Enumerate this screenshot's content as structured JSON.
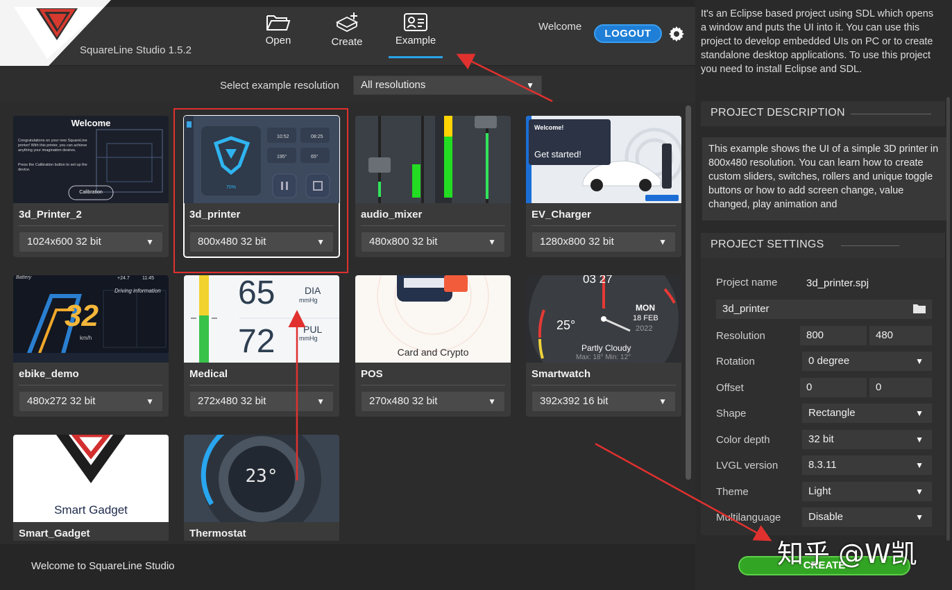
{
  "app": {
    "name": "SquareLine Studio 1.5.2",
    "welcome": "Welcome",
    "logout": "LOGOUT"
  },
  "nav": [
    {
      "label": "Open",
      "icon": "folder-icon"
    },
    {
      "label": "Create",
      "icon": "create-icon"
    },
    {
      "label": "Example",
      "icon": "example-icon",
      "active": true
    }
  ],
  "resolution": {
    "label": "Select example resolution",
    "value": "All resolutions"
  },
  "examples": [
    {
      "name": "3d_Printer_2",
      "res": "1024x600 32 bit"
    },
    {
      "name": "3d_printer",
      "res": "800x480 32 bit",
      "selected": true
    },
    {
      "name": "audio_mixer",
      "res": "480x800 32 bit"
    },
    {
      "name": "EV_Charger",
      "res": "1280x800 32 bit"
    },
    {
      "name": "ebike_demo",
      "res": "480x272 32 bit"
    },
    {
      "name": "Medical",
      "res": "272x480 32 bit"
    },
    {
      "name": "POS",
      "res": "270x480 32 bit"
    },
    {
      "name": "Smartwatch",
      "res": "392x392 16 bit"
    },
    {
      "name": "Smart_Gadget",
      "res": ""
    },
    {
      "name": "Thermostat",
      "res": ""
    }
  ],
  "thumbs": {
    "printer2": {
      "title": "Welcome",
      "text": "Congratulations on your new SquareLine printer! With this printer, you can achieve anything your imagination desires.",
      "hint": "Press the Calibration button to set up the device.",
      "button": "Calibration"
    },
    "printer": {
      "percent": "70%",
      "t1": "10:52",
      "t2": "08:25",
      "t3": "195°",
      "t4": "65°"
    },
    "ev": {
      "title": "Welcome!",
      "cta": "Get started!"
    },
    "ebike": {
      "battery": "Battery",
      "speed": "32",
      "unit": "km/h",
      "info": "Driving information",
      "temp": "+24.7",
      "clock": "11:45"
    },
    "medical": {
      "v1": "65",
      "l1": "DIA",
      "u1": "mmHg",
      "v2": "72",
      "l2": "PUL",
      "u2": "mmHg"
    },
    "pos": {
      "text": "Card and Crypto"
    },
    "watch": {
      "time": "03 27",
      "day": "MON",
      "date": "18 FEB",
      "year": "2022",
      "temp": "25°",
      "weather": "Partly Cloudy",
      "minmax": "Max: 18° Min: 12°"
    },
    "gadget": {
      "text": "Smart Gadget"
    },
    "thermo": {
      "temp": "23°"
    }
  },
  "footer": "Welcome to SquareLine Studio",
  "right": {
    "intro": "It's an Eclipse based project using SDL which opens a window and puts the UI into it. You can use this project to develop embedded UIs on PC or to create standalone desktop applications. To use this project you need to install Eclipse and SDL.",
    "desc_header": "PROJECT DESCRIPTION",
    "desc": "This example shows the UI of a simple 3D printer in 800x480 resolution. You can learn how to create custom sliders, switches, rollers and unique toggle buttons or how to add screen change, value changed, play animation and",
    "settings_header": "PROJECT SETTINGS",
    "project_name_label": "Project name",
    "project_name": "3d_printer.spj",
    "folder": "3d_printer",
    "resolution_label": "Resolution",
    "res_w": "800",
    "res_h": "480",
    "rotation_label": "Rotation",
    "rotation": "0 degree",
    "offset_label": "Offset",
    "off_x": "0",
    "off_y": "0",
    "shape_label": "Shape",
    "shape": "Rectangle",
    "depth_label": "Color depth",
    "depth": "32 bit",
    "lvgl_label": "LVGL version",
    "lvgl": "8.3.11",
    "theme_label": "Theme",
    "theme": "Light",
    "multi_label": "Multilanguage",
    "multi": "Disable",
    "create": "CREATE"
  },
  "watermark": "知乎 @W凯",
  "colors": {
    "accent": "#2aa3e8",
    "create": "#33a524",
    "annotation": "#e0312f"
  }
}
